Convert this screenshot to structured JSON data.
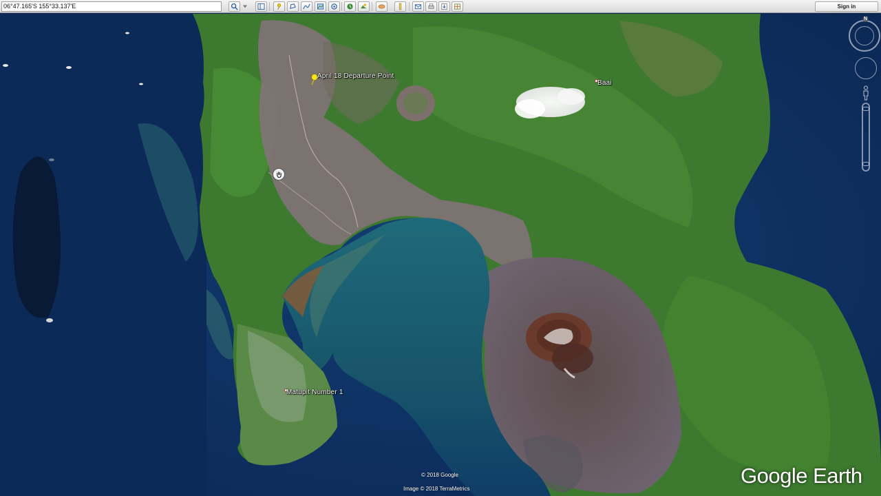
{
  "toolbar": {
    "coordinates": "06°47.165'S 155°33.137'E",
    "sign_in_label": "Sign in",
    "tools": [
      {
        "name": "search-icon",
        "glyph": "⌕"
      },
      {
        "name": "dropdown-icon",
        "glyph": "▾"
      },
      {
        "name": "sidebar-icon",
        "glyph": "▤"
      },
      {
        "name": "placemark-icon",
        "glyph": "⚲"
      },
      {
        "name": "polygon-icon",
        "glyph": "⬠"
      },
      {
        "name": "path-icon",
        "glyph": "⤳"
      },
      {
        "name": "image-overlay-icon",
        "glyph": "▣"
      },
      {
        "name": "tour-icon",
        "glyph": "◎"
      },
      {
        "name": "historical-imagery-icon",
        "glyph": "◷"
      },
      {
        "name": "sunlight-icon",
        "glyph": "☀"
      },
      {
        "name": "planets-icon",
        "glyph": "◐"
      },
      {
        "name": "ruler-icon",
        "glyph": "▮"
      },
      {
        "name": "email-icon",
        "glyph": "✉"
      },
      {
        "name": "print-icon",
        "glyph": "⎙"
      },
      {
        "name": "save-image-icon",
        "glyph": "⇩"
      },
      {
        "name": "view-in-maps-icon",
        "glyph": "▦"
      }
    ]
  },
  "map": {
    "placemarks": [
      {
        "label": "April 18 Departure Point",
        "type": "pushpin"
      },
      {
        "label": "Baai",
        "type": "dot"
      },
      {
        "label": "Matupit Number 1",
        "type": "dot"
      }
    ],
    "navigation": {
      "north_label": "N"
    },
    "copyright_lines": [
      "© 2018 Google",
      "Image © 2018 TerraMetrics"
    ],
    "brand": "Google Earth"
  },
  "colors": {
    "ocean_deep": "#0c2a55",
    "land_green": "#3f7a2e",
    "ash_grey": "#7f7278",
    "pushpin_yellow": "#f5e51c"
  }
}
